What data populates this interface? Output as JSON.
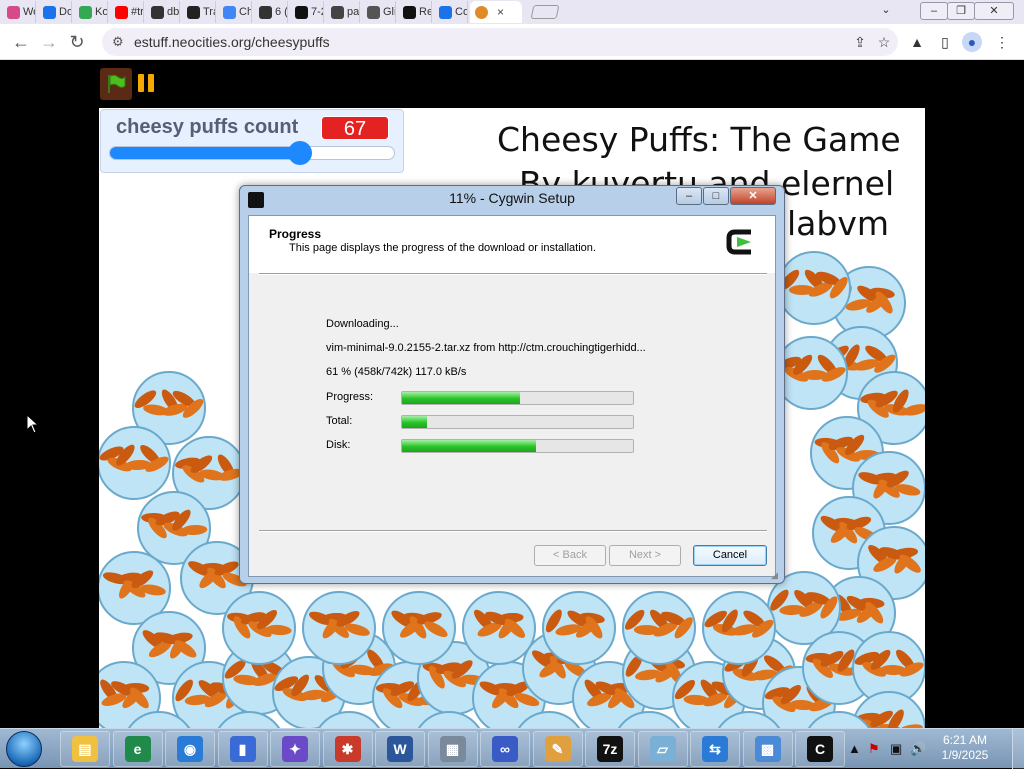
{
  "browser": {
    "tabs": [
      {
        "label": "Wo",
        "color": "#d64a8a"
      },
      {
        "label": "Do",
        "color": "#1a73e8"
      },
      {
        "label": "Ko",
        "color": "#34a853"
      },
      {
        "label": "#tr",
        "color": "#ff0000"
      },
      {
        "label": "db",
        "color": "#333333"
      },
      {
        "label": "Tra",
        "color": "#222222"
      },
      {
        "label": "Ch",
        "color": "#4285f4"
      },
      {
        "label": "6 (",
        "color": "#333333"
      },
      {
        "label": "7-2",
        "color": "#111111"
      },
      {
        "label": "pa",
        "color": "#444444"
      },
      {
        "label": "Gli",
        "color": "#555555"
      },
      {
        "label": "Re",
        "color": "#111111"
      },
      {
        "label": "Co",
        "color": "#1a73e8"
      }
    ],
    "active_tab_close": "×",
    "url": "estuff.neocities.org/cheesypuffs"
  },
  "scratch": {
    "monitor_label": "cheesy puffs count",
    "monitor_value": "67",
    "slider_fraction": 0.67,
    "title_line1": "Cheesy Puffs: The Game",
    "title_line2": "By kuyertu and elernel",
    "title_line3": "labvm"
  },
  "dialog": {
    "title": "11% - Cygwin Setup",
    "header_title": "Progress",
    "header_desc": "This page displays the progress of the download or installation.",
    "status": "Downloading...",
    "file": "vim-minimal-9.0.2155-2.tar.xz from http://ctm.crouchingtigerhidd...",
    "stats": "61 %  (458k/742k)  117.0 kB/s",
    "bars": [
      {
        "label": "Progress:",
        "value": 0.51
      },
      {
        "label": "Total:",
        "value": 0.11
      },
      {
        "label": "Disk:",
        "value": 0.58
      }
    ],
    "back_label": "< Back",
    "next_label": "Next >",
    "cancel_label": "Cancel"
  },
  "taskbar": {
    "apps": [
      "explorer",
      "edge",
      "browser",
      "usb",
      "game",
      "spider",
      "word",
      "installer",
      "infinity",
      "paint",
      "7z",
      "notepad",
      "remote",
      "network",
      "cygwin"
    ],
    "time": "6:21 AM",
    "date": "1/9/2025"
  }
}
